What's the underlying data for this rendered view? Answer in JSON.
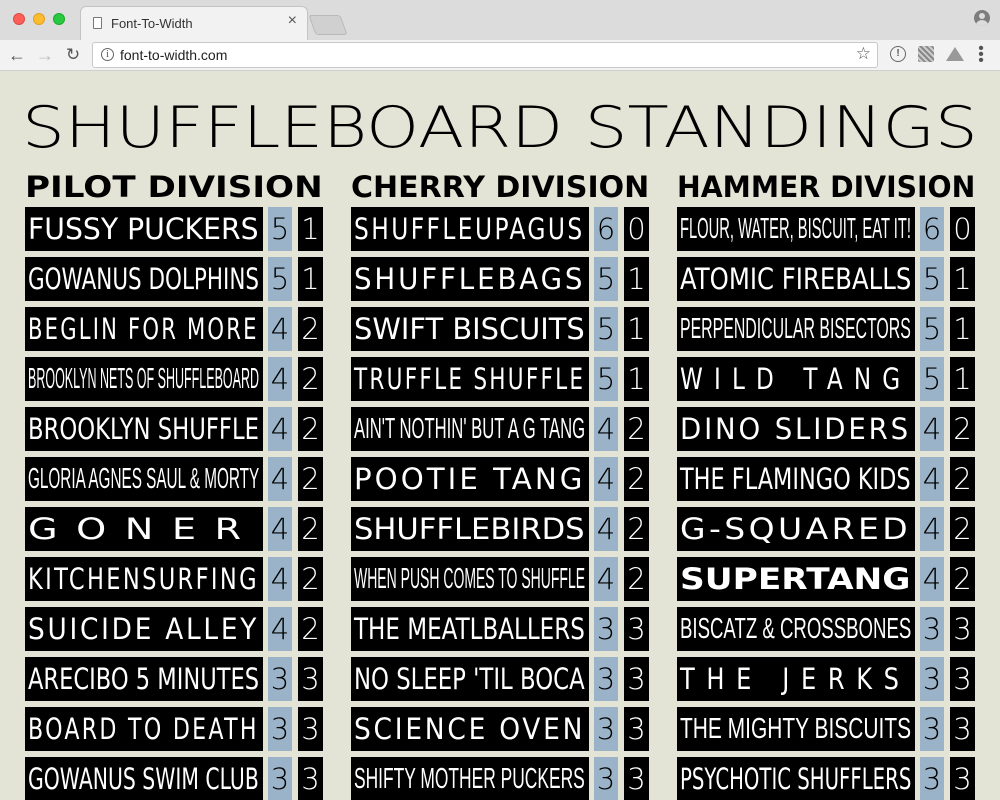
{
  "browser": {
    "tab_title": "Font-To-Width",
    "tab_close": "×",
    "url": "font-to-width.com"
  },
  "title": "SHUFFLEBOARD STANDINGS",
  "divisions": [
    {
      "name": "PILOT DIVISION",
      "teams": [
        {
          "name": "FUSSY PUCKERS",
          "wins": "5",
          "losses": "1",
          "style": "f-sans"
        },
        {
          "name": "GOWANUS DOLPHINS",
          "wins": "5",
          "losses": "1",
          "style": "f-sans"
        },
        {
          "name": "BEGLIN FOR MORE",
          "wins": "4",
          "losses": "2",
          "style": "f-wide"
        },
        {
          "name": "BROOKLYN NETS OF SHUFFLEBOARD",
          "wins": "4",
          "losses": "2",
          "style": "f-cond"
        },
        {
          "name": "BROOKLYN SHUFFLE",
          "wins": "4",
          "losses": "2",
          "style": "f-sans"
        },
        {
          "name": "GLORIA AGNES SAUL & MORTY",
          "wins": "4",
          "losses": "2",
          "style": "f-cond"
        },
        {
          "name": "GONER",
          "wins": "4",
          "losses": "2",
          "style": "f-xwide"
        },
        {
          "name": "KITCHENSURFING",
          "wins": "4",
          "losses": "2",
          "style": "f-wide"
        },
        {
          "name": "SUICIDE ALLEY",
          "wins": "4",
          "losses": "2",
          "style": "f-wide"
        },
        {
          "name": "ARECIBO 5 MINUTES",
          "wins": "3",
          "losses": "3",
          "style": "f-sans"
        },
        {
          "name": "BOARD TO DEATH",
          "wins": "3",
          "losses": "3",
          "style": "f-wide"
        },
        {
          "name": "GOWANUS SWIM CLUB",
          "wins": "3",
          "losses": "3",
          "style": "f-sans"
        }
      ]
    },
    {
      "name": "CHERRY DIVISION",
      "teams": [
        {
          "name": "SHUFFLEUPAGUS",
          "wins": "6",
          "losses": "0",
          "style": "f-wide"
        },
        {
          "name": "SHUFFLEBAGS",
          "wins": "5",
          "losses": "1",
          "style": "f-wide"
        },
        {
          "name": "SWIFT BISCUITS",
          "wins": "5",
          "losses": "1",
          "style": "f-sans"
        },
        {
          "name": "TRUFFLE SHUFFLE",
          "wins": "5",
          "losses": "1",
          "style": "f-wide"
        },
        {
          "name": "AIN'T NOTHIN' BUT A G TANG",
          "wins": "4",
          "losses": "2",
          "style": "f-cond"
        },
        {
          "name": "POOTIE TANG",
          "wins": "4",
          "losses": "2",
          "style": "f-wide"
        },
        {
          "name": "SHUFFLEBIRDS",
          "wins": "4",
          "losses": "2",
          "style": "f-sans"
        },
        {
          "name": "WHEN PUSH COMES TO SHUFFLE",
          "wins": "4",
          "losses": "2",
          "style": "f-cond"
        },
        {
          "name": "THE MEATLBALLERS",
          "wins": "3",
          "losses": "3",
          "style": "f-sans"
        },
        {
          "name": "NO SLEEP 'TIL BOCA",
          "wins": "3",
          "losses": "3",
          "style": "f-sans"
        },
        {
          "name": "SCIENCE OVEN",
          "wins": "3",
          "losses": "3",
          "style": "f-wide"
        },
        {
          "name": "SHIFTY MOTHER PUCKERS",
          "wins": "3",
          "losses": "3",
          "style": "f-cond"
        }
      ]
    },
    {
      "name": "HAMMER DIVISION",
      "teams": [
        {
          "name": "FLOUR, WATER, BISCUIT, EAT IT!",
          "wins": "6",
          "losses": "0",
          "style": "f-cond"
        },
        {
          "name": "ATOMIC FIREBALLS",
          "wins": "5",
          "losses": "1",
          "style": "f-sans"
        },
        {
          "name": "PERPENDICULAR BISECTORS",
          "wins": "5",
          "losses": "1",
          "style": "f-cond"
        },
        {
          "name": "WILD TANG",
          "wins": "5",
          "losses": "1",
          "style": "f-xwide"
        },
        {
          "name": "DINO SLIDERS",
          "wins": "4",
          "losses": "2",
          "style": "f-wide"
        },
        {
          "name": "THE FLAMINGO KIDS",
          "wins": "4",
          "losses": "2",
          "style": "f-sans"
        },
        {
          "name": "G-SQUARED",
          "wins": "4",
          "losses": "2",
          "style": "f-wide"
        },
        {
          "name": "SUPERTANG",
          "wins": "4",
          "losses": "2",
          "style": "f-bold"
        },
        {
          "name": "BISCATZ & CROSSBONES",
          "wins": "3",
          "losses": "3",
          "style": "f-cond"
        },
        {
          "name": "THE JERKS",
          "wins": "3",
          "losses": "3",
          "style": "f-xwide"
        },
        {
          "name": "THE MIGHTY BISCUITS",
          "wins": "3",
          "losses": "3",
          "style": "f-cond"
        },
        {
          "name": "PSYCHOTIC SHUFFLERS",
          "wins": "3",
          "losses": "3",
          "style": "f-sans"
        }
      ]
    }
  ]
}
